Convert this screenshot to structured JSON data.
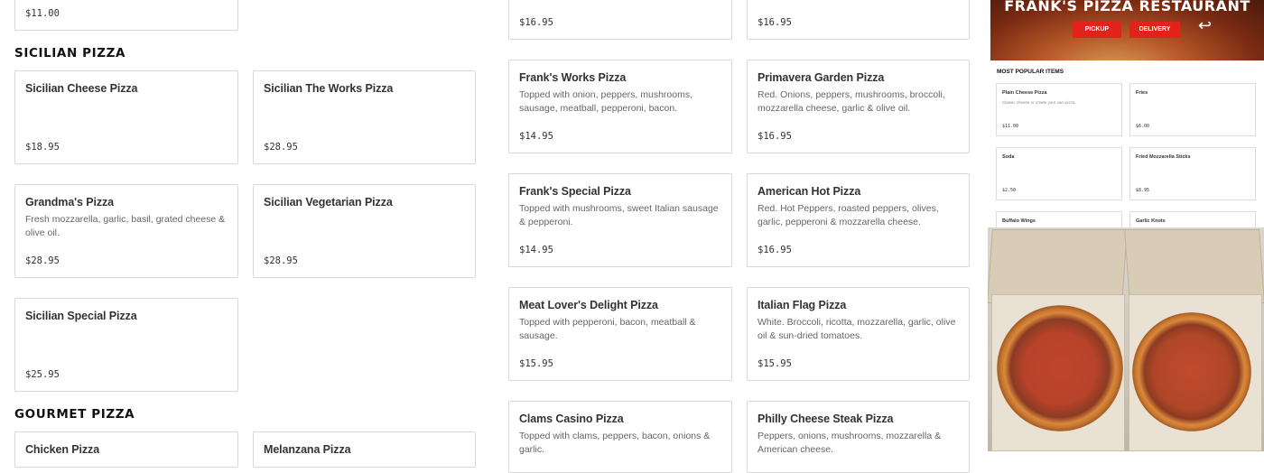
{
  "left_column": {
    "top_price": "$11.00",
    "sicilian_title": "SICILIAN PIZZA",
    "sicilian_items": [
      {
        "name": "Sicilian Cheese Pizza",
        "desc": "",
        "price": "$18.95"
      },
      {
        "name": "Sicilian The Works Pizza",
        "desc": "",
        "price": "$28.95"
      },
      {
        "name": "Grandma's Pizza",
        "desc": "Fresh mozzarella, garlic, basil, grated cheese & olive oil.",
        "price": "$28.95"
      },
      {
        "name": "Sicilian Vegetarian Pizza",
        "desc": "",
        "price": "$28.95"
      },
      {
        "name": "Sicilian Special Pizza",
        "desc": "",
        "price": "$25.95"
      }
    ],
    "gourmet_title": "GOURMET PIZZA",
    "gourmet_items": [
      {
        "name": "Chicken Pizza"
      },
      {
        "name": "Melanzana Pizza"
      }
    ]
  },
  "middle_column": {
    "top_prices": [
      "$16.95",
      "$16.95"
    ],
    "items": [
      {
        "name": "Frank's Works Pizza",
        "desc": "Topped with onion, peppers, mushrooms, sausage, meatball, pepperoni, bacon.",
        "price": "$14.95"
      },
      {
        "name": "Primavera Garden Pizza",
        "desc": "Red. Onions, peppers, mushrooms, broccoli, mozzarella cheese, garlic & olive oil.",
        "price": "$16.95"
      },
      {
        "name": "Frank's Special Pizza",
        "desc": "Topped with mushrooms, sweet Italian sausage & pepperoni.",
        "price": "$14.95"
      },
      {
        "name": "American Hot Pizza",
        "desc": "Red. Hot Peppers, roasted peppers, olives, garlic, pepperoni & mozzarella cheese.",
        "price": "$16.95"
      },
      {
        "name": "Meat Lover's Delight Pizza",
        "desc": "Topped with pepperoni, bacon, meatball & sausage.",
        "price": "$15.95"
      },
      {
        "name": "Italian Flag Pizza",
        "desc": "White. Broccoli, ricotta, mozzarella, garlic, olive oil & sun-dried tomatoes.",
        "price": "$15.95"
      },
      {
        "name": "Clams Casino Pizza",
        "desc": "Topped with clams, peppers, bacon, onions & garlic.",
        "price": ""
      },
      {
        "name": "Philly Cheese Steak Pizza",
        "desc": "Peppers, onions, mushrooms, mozzarella & American cheese.",
        "price": ""
      }
    ]
  },
  "promo": {
    "brand": "FRANK'S PIZZA RESTAURANT",
    "pickup": "PICKUP",
    "delivery": "DELIVERY",
    "popular_title": "MOST POPULAR ITEMS",
    "popular_items": [
      {
        "name": "Plain Cheese Pizza",
        "desc": "Classic cheese or create your own pizza.",
        "price": "$11.00"
      },
      {
        "name": "Fries",
        "desc": "",
        "price": "$6.00"
      },
      {
        "name": "Soda",
        "desc": "",
        "price": "$2.50"
      },
      {
        "name": "Fried Mozzarella Sticks",
        "desc": "",
        "price": "$8.95"
      },
      {
        "name": "Buffalo Wings",
        "desc": "",
        "price": ""
      },
      {
        "name": "Garlic Knots",
        "desc": "",
        "price": ""
      }
    ]
  }
}
